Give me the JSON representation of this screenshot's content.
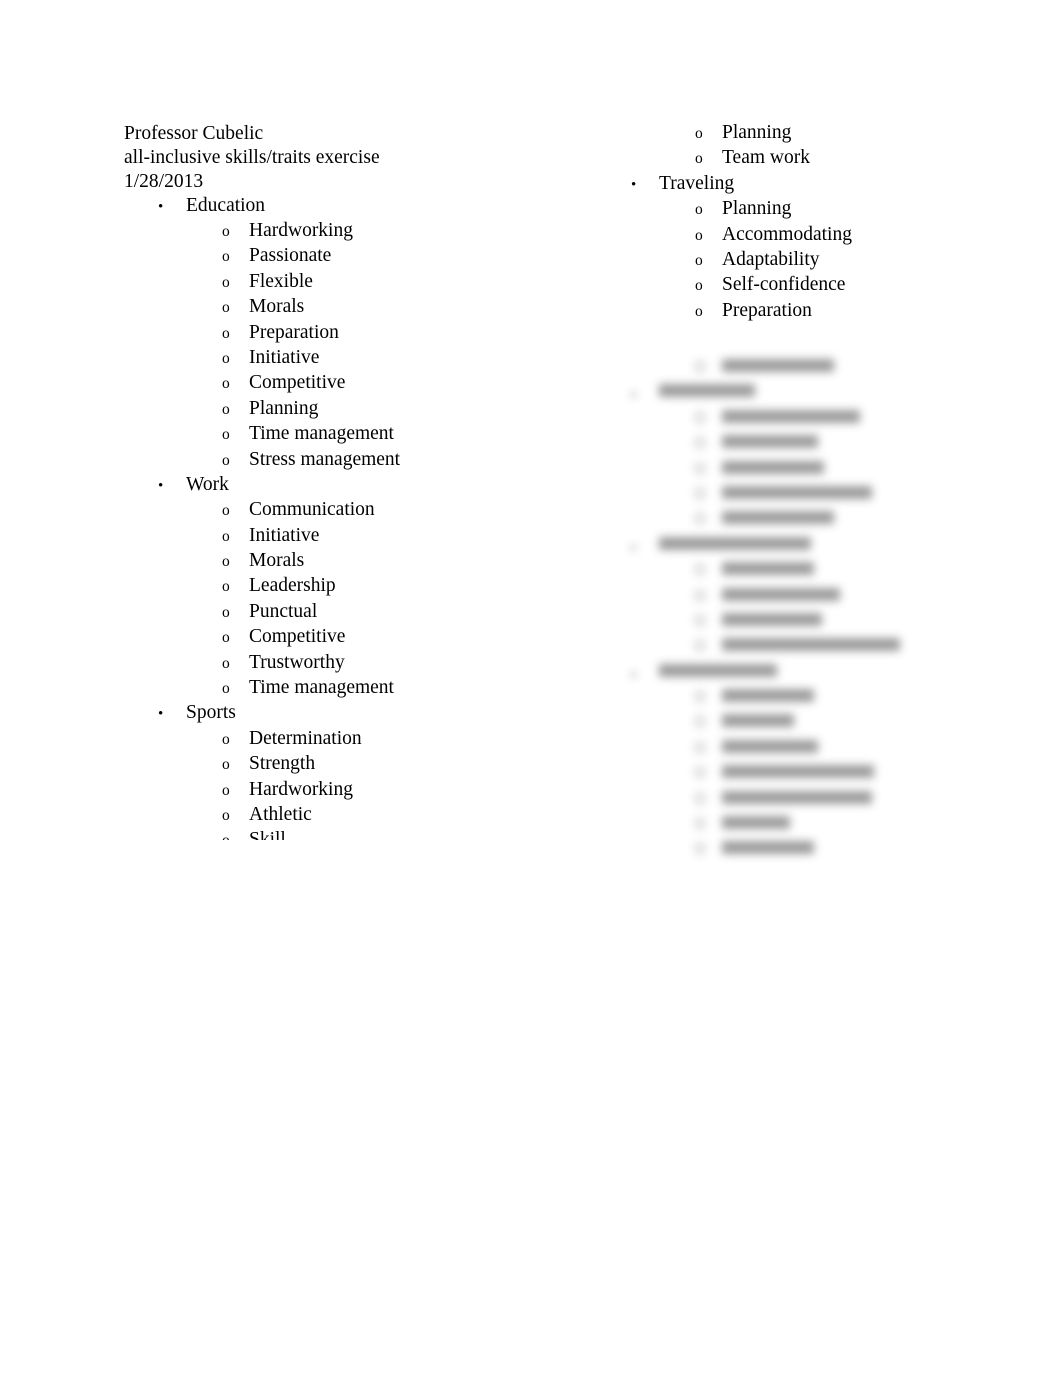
{
  "document": {
    "header_lines": [
      "Professor Cubelic",
      "all-inclusive skills/traits exercise",
      "1/28/2013"
    ],
    "bullet_marker": "•",
    "sub_marker": "o",
    "left_column": [
      {
        "heading": "Education",
        "items": [
          "Hardworking",
          "Passionate",
          "Flexible",
          "Morals",
          "Preparation",
          "Initiative",
          "Competitive",
          "Planning",
          "Time management",
          "Stress management"
        ]
      },
      {
        "heading": "Work",
        "items": [
          "Communication",
          "Initiative",
          "Morals",
          "Leadership",
          "Punctual",
          "Competitive",
          "Trustworthy",
          "Time management"
        ]
      },
      {
        "heading": "Sports",
        "items": [
          "Determination",
          "Strength",
          "Hardworking",
          "Athletic"
        ],
        "clipped_item": "Skill"
      }
    ],
    "right_column_top": {
      "continued_items": [
        "Planning",
        "Team work"
      ],
      "group": {
        "heading": "Traveling",
        "items": [
          "Planning",
          "Accommodating",
          "Adaptability",
          "Self-confidence",
          "Preparation"
        ]
      }
    },
    "right_column_blurred": {
      "note": "illegible",
      "groups": [
        {
          "heading_width": 96,
          "items_widths": [
            138,
            96,
            102,
            150,
            112
          ]
        },
        {
          "heading_width": 152,
          "items_widths": [
            92,
            118,
            100,
            178
          ]
        },
        {
          "heading_width": 118,
          "items_widths": [
            92,
            72,
            96,
            152,
            150,
            68,
            92
          ]
        }
      ],
      "trailing_item_width": 112
    }
  }
}
